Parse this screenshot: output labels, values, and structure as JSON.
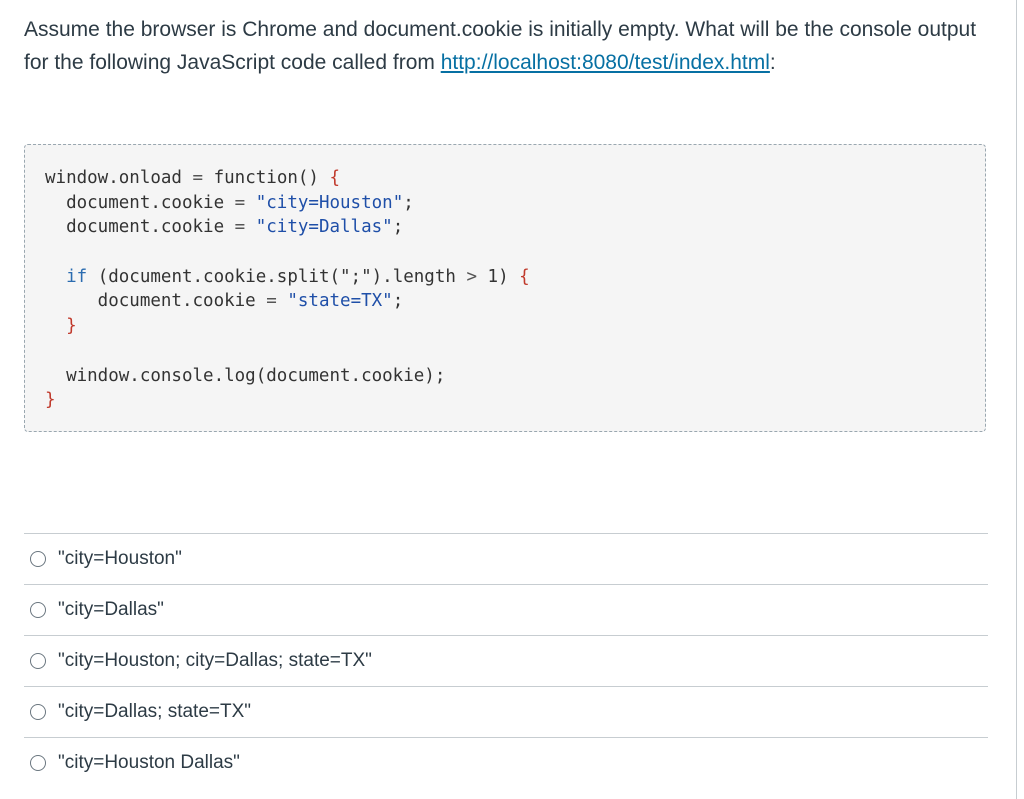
{
  "question": {
    "text_before_link": "Assume the browser is Chrome and document.cookie is initially empty.   What will be the console output for the following JavaScript code called from ",
    "link_text": "http://localhost:8080/test/index.html",
    "text_after_link": ":"
  },
  "code": {
    "line1_a": "window.onload ",
    "line1_op": "=",
    "line1_b": " function() ",
    "line1_brace": "{",
    "line2_a": "  document.cookie ",
    "line2_op": "=",
    "line2_str": " \"city=Houston\"",
    "line2_end": ";",
    "line3_a": "  document.cookie ",
    "line3_op": "=",
    "line3_str": " \"city=Dallas\"",
    "line3_end": ";",
    "line5_kw": "  if",
    "line5_a": " (document.cookie.split(\";\").length ",
    "line5_op": ">",
    "line5_b": " 1) ",
    "line5_brace": "{",
    "line6_a": "     document.cookie ",
    "line6_op": "=",
    "line6_str": " \"state=TX\"",
    "line6_end": ";",
    "line7_brace": "  }",
    "line9": "  window.console.log(document.cookie);",
    "line10_brace": "}"
  },
  "answers": [
    {
      "label": "\"city=Houston\"",
      "selected": false
    },
    {
      "label": "\"city=Dallas\"",
      "selected": false
    },
    {
      "label": "\"city=Houston; city=Dallas; state=TX\"",
      "selected": false
    },
    {
      "label": "\"city=Dallas; state=TX\"",
      "selected": false
    },
    {
      "label": "\"city=Houston Dallas\"",
      "selected": false
    }
  ]
}
